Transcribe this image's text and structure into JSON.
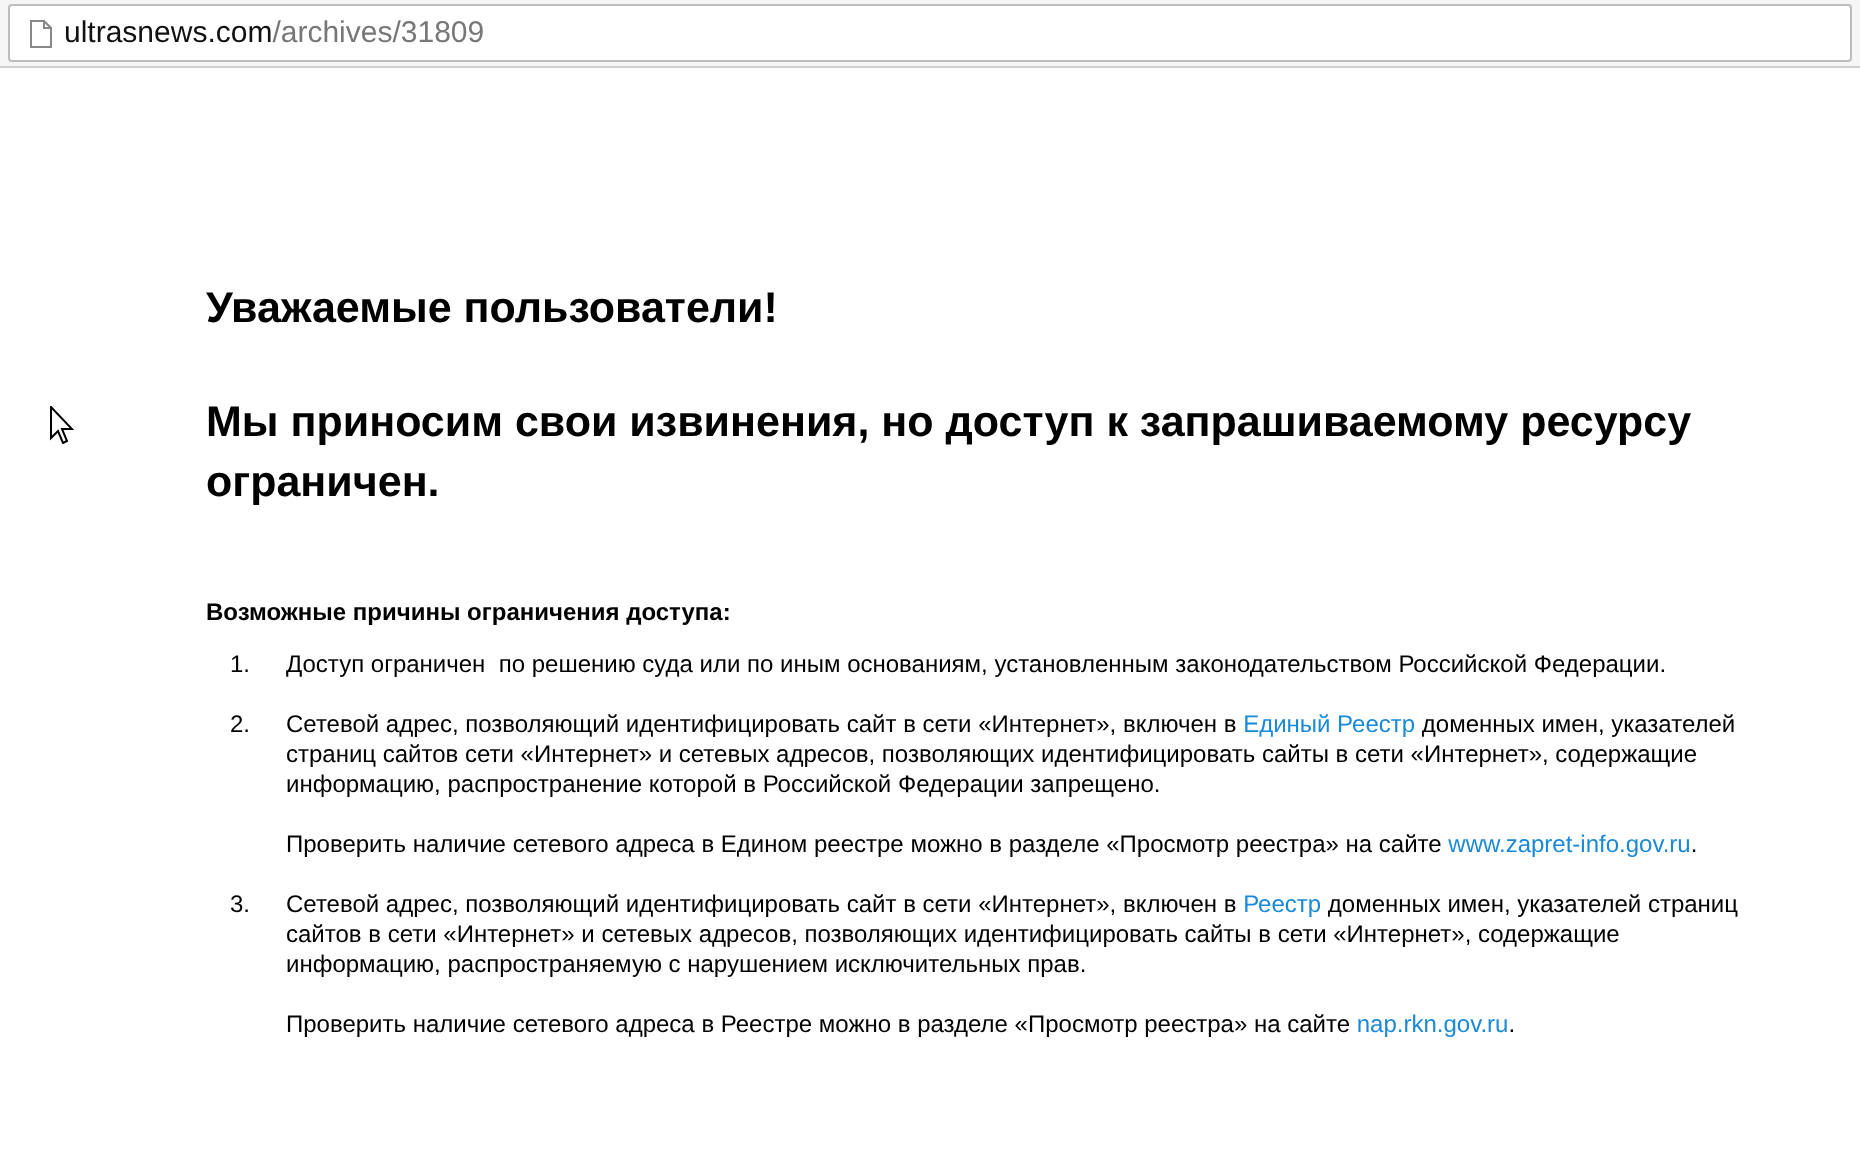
{
  "address_bar": {
    "domain": "ultrasnews.com",
    "path": "/archives/31809"
  },
  "headings": [
    "Уважаемые пользователи!",
    "Мы приносим свои извинения, но доступ к запрашиваемому ресурсу ограничен."
  ],
  "reasons_title": "Возможные причины ограничения доступа:",
  "reasons": [
    {
      "number": "1.",
      "paragraphs": [
        [
          {
            "kind": "text",
            "text": "Доступ ограничен  по решению суда или по иным основаниям, установленным законодательством Российской Федерации."
          }
        ]
      ]
    },
    {
      "number": "2.",
      "paragraphs": [
        [
          {
            "kind": "text",
            "text": "Сетевой адрес, позволяющий идентифицировать сайт в сети «Интернет», включен в "
          },
          {
            "kind": "link",
            "text": "Единый Реестр"
          },
          {
            "kind": "text",
            "text": " доменных имен, указателей страниц сайтов сети «Интернет» и сетевых адресов, позволяющих идентифицировать сайты в сети «Интернет», содержащие информацию, распространение которой в Российской Федерации запрещено."
          }
        ],
        [
          {
            "kind": "text",
            "text": "Проверить наличие сетевого адреса в Едином реестре можно в разделе «Просмотр реестра» на сайте "
          },
          {
            "kind": "link",
            "text": "www.zapret-info.gov.ru"
          },
          {
            "kind": "text",
            "text": "."
          }
        ]
      ]
    },
    {
      "number": "3.",
      "paragraphs": [
        [
          {
            "kind": "text",
            "text": "Сетевой адрес, позволяющий идентифицировать сайт в сети «Интернет», включен в "
          },
          {
            "kind": "link",
            "text": "Реестр"
          },
          {
            "kind": "text",
            "text": " доменных имен, указателей страниц сайтов в сети «Интернет» и сетевых адресов, позволяющих идентифицировать сайты в сети «Интернет», содержащие информацию, распространяемую с нарушением исключительных прав."
          }
        ],
        [
          {
            "kind": "text",
            "text": "Проверить наличие сетевого адреса в Реестре можно в разделе «Просмотр реестра» на сайте "
          },
          {
            "kind": "link",
            "text": "nap.rkn.gov.ru"
          },
          {
            "kind": "text",
            "text": "."
          }
        ]
      ]
    }
  ]
}
